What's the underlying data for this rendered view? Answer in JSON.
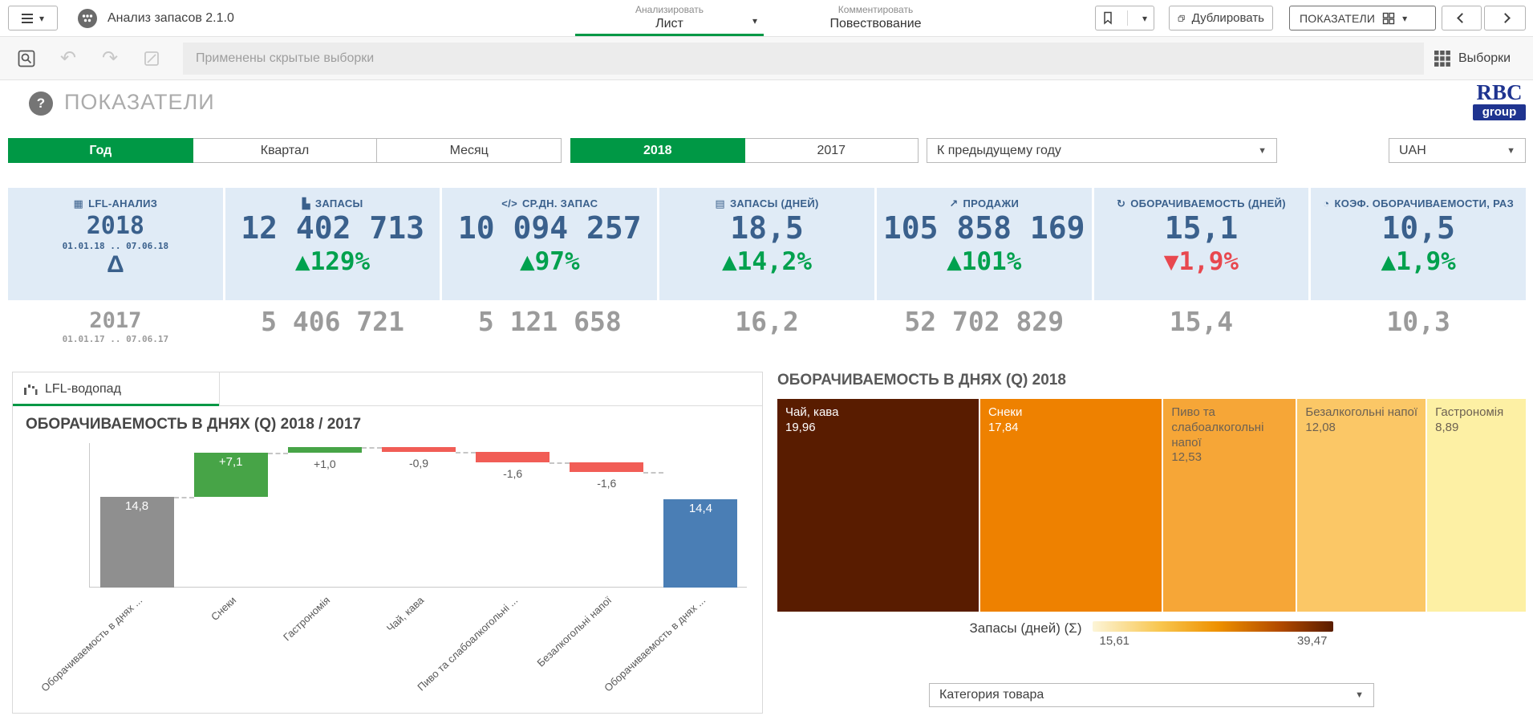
{
  "colors": {
    "green": "#009845",
    "green_bright": "#00a14e",
    "red": "#e8484f",
    "navy": "#3a608c",
    "kpi_bg": "#e0ebf6",
    "gray_value": "#9b9b9b"
  },
  "topbar": {
    "app_title": "Анализ запасов 2.1.0",
    "nav_items": [
      {
        "small": "Анализировать",
        "label": "Лист",
        "active": true
      },
      {
        "small": "Комментировать",
        "label": "Повествование",
        "active": false
      }
    ],
    "duplicate_label": "Дублировать",
    "sheet_button_label": "ПОКАЗАТЕЛИ"
  },
  "toolbar": {
    "status_text": "Применены скрытые выборки",
    "selections_label": "Выборки"
  },
  "header": {
    "title": "ПОКАЗАТЕЛИ",
    "logo_top": "RBC",
    "logo_bottom": "group"
  },
  "filters": {
    "period_buttons": [
      {
        "label": "Год",
        "selected": true
      },
      {
        "label": "Квартал",
        "selected": false
      },
      {
        "label": "Месяц",
        "selected": false
      }
    ],
    "year_buttons": [
      {
        "label": "2018",
        "selected": true
      },
      {
        "label": "2017",
        "selected": false
      }
    ],
    "compare_dropdown_value": "К предыдущему году",
    "currency_dropdown_value": "UAH"
  },
  "kpis": [
    {
      "icon": "calendar-icon",
      "label": "LFL-АНАЛИЗ",
      "value": "2018",
      "subtitle": "01.01.18 .. 07.06.18",
      "delta_symbol": "Δ",
      "previous": "2017",
      "previous_subtitle": "01.01.17 .. 07.06.17"
    },
    {
      "icon": "stock-icon",
      "label": "ЗАПАСЫ",
      "value": "12 402 713",
      "change": "129%",
      "direction": "up",
      "previous": "5 406 721"
    },
    {
      "icon": "avg-stock-icon",
      "label": "СР.ДН. ЗАПАС",
      "value": "10 094 257",
      "change": "97%",
      "direction": "up",
      "previous": "5 121 658"
    },
    {
      "icon": "stock-days-icon",
      "label": "ЗАПАСЫ (ДНЕЙ)",
      "value": "18,5",
      "change": "14,2%",
      "direction": "up",
      "previous": "16,2"
    },
    {
      "icon": "sales-icon",
      "label": "ПРОДАЖИ",
      "value": "105 858 169",
      "change": "101%",
      "direction": "up",
      "previous": "52 702 829"
    },
    {
      "icon": "turnover-days-icon",
      "label": "ОБОРАЧИВАЕМОСТЬ (ДНЕЙ)",
      "value": "15,1",
      "change": "1,9%",
      "direction": "down",
      "previous": "15,4"
    },
    {
      "icon": "turnover-ratio-icon",
      "label": "КОЭФ. ОБОРАЧИВАЕМОСТИ, РАЗ",
      "value": "10,5",
      "change": "1,9%",
      "direction": "up",
      "previous": "10,3"
    }
  ],
  "left_panel": {
    "tab_label": "LFL-водопад"
  },
  "right_panel": {
    "category_dropdown_value": "Категория товара"
  },
  "chart_data": [
    {
      "type": "bar",
      "subtype": "waterfall",
      "title": "ОБОРАЧИВАЕМОСТЬ В ДНЯХ (Q) 2018 / 2017",
      "categories": [
        "Оборачиваемость в днях ...",
        "Снеки",
        "Гастрономія",
        "Чай, кава",
        "Пиво та слабоалкогольні ...",
        "Безалкогольні напої",
        "Оборачиваемость в днях ..."
      ],
      "values": [
        14.8,
        7.1,
        1.0,
        -0.9,
        -1.6,
        -1.6,
        14.4
      ],
      "labels": [
        "14,8",
        "+7,1",
        "+1,0",
        "-0,9",
        "-1,6",
        "-1,6",
        "14,4"
      ],
      "bar_roles": [
        "start",
        "increase",
        "increase",
        "decrease",
        "decrease",
        "decrease",
        "end"
      ],
      "colors": {
        "start": "#8f8f8f",
        "increase": "#47a447",
        "decrease": "#f15d56",
        "end": "#4a7eb5"
      },
      "ylim": [
        0,
        23.5
      ],
      "grid": false,
      "xlabel": "",
      "ylabel": "",
      "legend_position": "none"
    },
    {
      "type": "treemap",
      "title": "ОБОРАЧИВАЕМОСТЬ В ДНЯХ (Q) 2018",
      "items": [
        {
          "label": "Чай, кава",
          "value": "19,96",
          "size": 19.96,
          "color": "#591c00",
          "text_color": "#ffffff"
        },
        {
          "label": "Снеки",
          "value": "17,84",
          "size": 17.84,
          "color": "#ee8100",
          "text_color": "#ffffff"
        },
        {
          "label": "Пиво та слабоалкогольні напої",
          "value": "12,53",
          "size": 12.53,
          "color": "#f6a637",
          "text_color": "#6d6152"
        },
        {
          "label": "Безалкогольні напої",
          "value": "12,08",
          "size": 12.08,
          "color": "#fbc766",
          "text_color": "#6d6152"
        },
        {
          "label": "Гастрономія",
          "value": "8,89",
          "size": 8.89,
          "color": "#fdf0a4",
          "text_color": "#6d6152"
        }
      ],
      "legend": {
        "label": "Запасы (дней) (Σ)",
        "min": "15,61",
        "max": "39,47",
        "position": "bottom-center"
      }
    }
  ]
}
